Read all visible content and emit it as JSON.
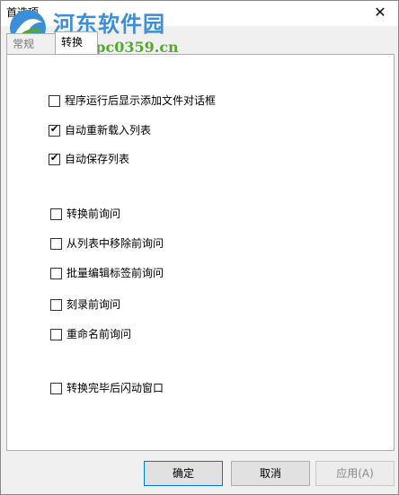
{
  "window": {
    "title": "首选项",
    "close_glyph": "✕"
  },
  "watermark": {
    "brand": "河东软件园",
    "url": "www.pc0359.cn"
  },
  "tabs": [
    {
      "label": "常规"
    },
    {
      "label": "转换"
    }
  ],
  "options": [
    {
      "label": "程序运行后显示添加文件对话框",
      "checked": false
    },
    {
      "label": "自动重新载入列表",
      "checked": true
    },
    {
      "label": "自动保存列表",
      "checked": true
    },
    {
      "label": "转换前询问",
      "checked": false
    },
    {
      "label": "从列表中移除前询问",
      "checked": false
    },
    {
      "label": "批量编辑标签前询问",
      "checked": false
    },
    {
      "label": "刻录前询问",
      "checked": false
    },
    {
      "label": "重命名前询问",
      "checked": false
    },
    {
      "label": "转换完毕后闪动窗口",
      "checked": false
    }
  ],
  "buttons": {
    "ok": "确定",
    "cancel": "取消",
    "apply": "应用(A)"
  },
  "colors": {
    "accent": "#0078d7",
    "watermark_blue": "#3a8fd8",
    "watermark_green": "#55a830"
  }
}
